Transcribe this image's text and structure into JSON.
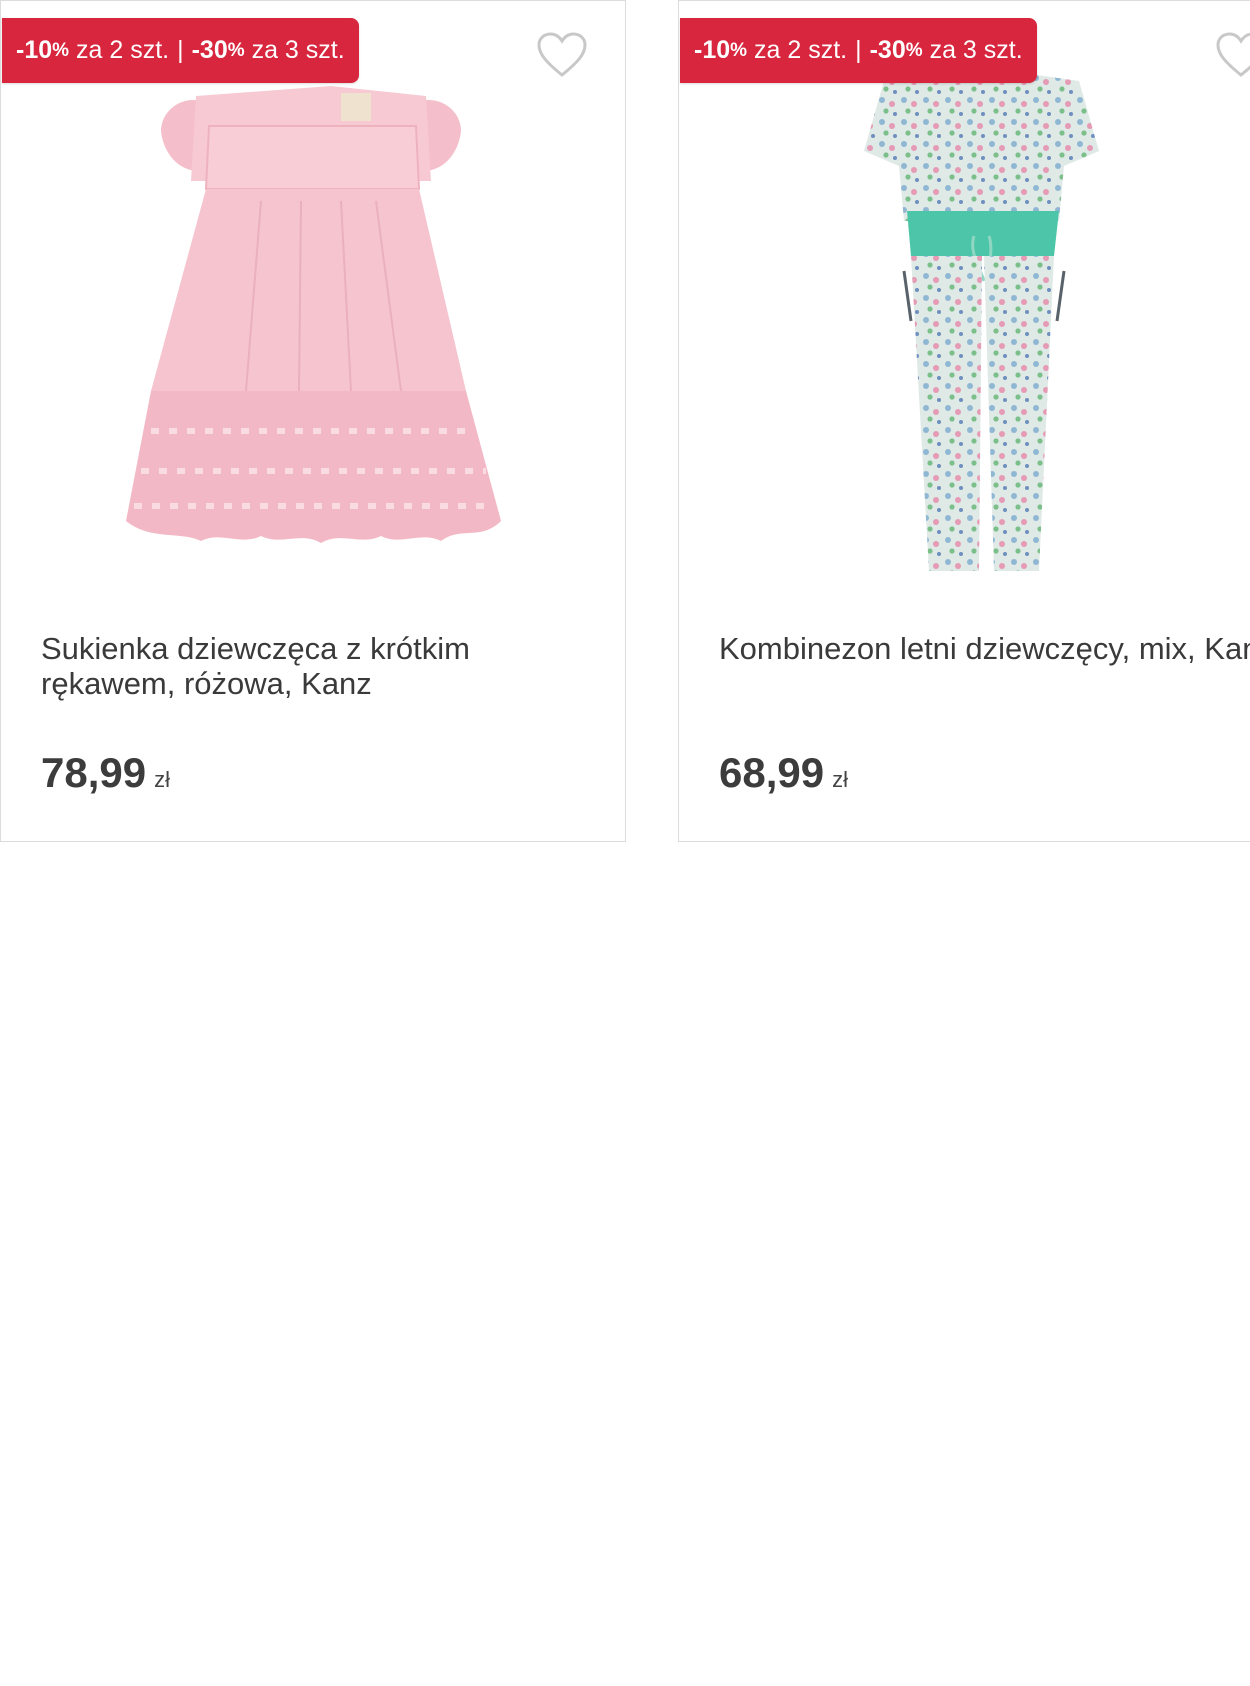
{
  "products": [
    {
      "promo": {
        "part1_value": "-10",
        "part1_pct": "%",
        "part1_text": " za 2 szt.",
        "separator": "|",
        "part2_value": "-30",
        "part2_pct": "%",
        "part2_text": " za 3 szt."
      },
      "title": "Sukienka dziewczęca z krótkim rękawem, różowa, Kanz",
      "price": "78,99",
      "currency": "zł",
      "image_colors": {
        "main": "#f6c6d0",
        "lace": "#f4b9c6",
        "trim": "#f8d6dd"
      }
    },
    {
      "promo": {
        "part1_value": "-10",
        "part1_pct": "%",
        "part1_text": " za 2 szt.",
        "separator": "|",
        "part2_value": "-30",
        "part2_pct": "%",
        "part2_text": " za 3 szt."
      },
      "title": "Kombinezon letni dziewczęcy, mix, Kanz",
      "price": "68,99",
      "currency": "zł",
      "image_colors": {
        "main": "#dfe9e6",
        "belt": "#4cc5a8",
        "dots1": "#8fb7d4",
        "dots2": "#e59ab5",
        "dots3": "#7bbf8a"
      }
    }
  ],
  "colors": {
    "promo_bg": "#d7263d",
    "heart_outline": "#c8c8c8"
  }
}
